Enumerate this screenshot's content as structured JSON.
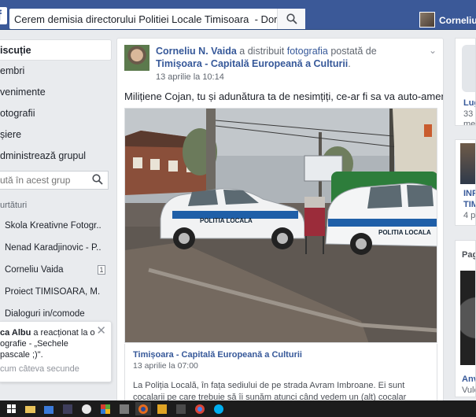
{
  "topbar": {
    "search_value": "Cerem demisia directorului Politiei Locale Timisoara  - Dorel CC",
    "user_name": "Corneliu"
  },
  "sidebar": {
    "items": [
      {
        "label": "iscuție",
        "active": true
      },
      {
        "label": "embri"
      },
      {
        "label": "venimente"
      },
      {
        "label": "otografii"
      },
      {
        "label": "șiere"
      },
      {
        "label": "dministrează grupul"
      }
    ],
    "search_placeholder": "ută în acest grup",
    "shortcuts_title": "urtături",
    "shortcuts": [
      {
        "label": "Škola Kreativne Fotogr..."
      },
      {
        "label": "Nenad Karadjinovic - P..."
      },
      {
        "label": "Corneliu Vaida",
        "count": "1"
      },
      {
        "label": "Proiect TIMISOARA, M..."
      },
      {
        "label": "Dialoguri in/comode"
      }
    ]
  },
  "notification": {
    "actor": "ca Albu",
    "text": " a reacționat la o",
    "line2": "ografie - „Sechele",
    "line3": "pascale ;)\".",
    "time": "cum câteva secunde"
  },
  "post": {
    "author": "Corneliu N. Vaida",
    "action": " a distribuit ",
    "object": "fotografia",
    "action2": " postată de ",
    "page": "Timișoara - Capitală Europeană a Culturii",
    "dot": ".",
    "timestamp": "13 aprilie la 10:14",
    "text": "Milițiene Cojan, tu și adunătura ta de nesimțiți, ce-ar fi sa va auto-amendați?",
    "car_label_1": "POLITIA LOCALA",
    "car_label_2": "POLITIA LOCALA",
    "shared_title": "Timișoara - Capitală Europeană a Culturii",
    "shared_date": "13 aprilie la 07:00",
    "shared_desc": "La Poliția Locală, în fața sediului de pe strada Avram Imbroane. Ei sunt cocalarii pe care trebuie să îi sunăm atunci când vedem un (alt) cocalar parcat aiurea..."
  },
  "right": {
    "r1_title": "Lug",
    "r1_line2": "33 c",
    "r1_line3": "mer",
    "r2_line1": "INF",
    "r2_line2": "TIM",
    "r2_line3": "4 p",
    "r3_title": "Pag",
    "r4_line1": "Anv",
    "r4_line2": "Vulc"
  },
  "colors": {
    "brand": "#3b5998",
    "link": "#365899"
  }
}
